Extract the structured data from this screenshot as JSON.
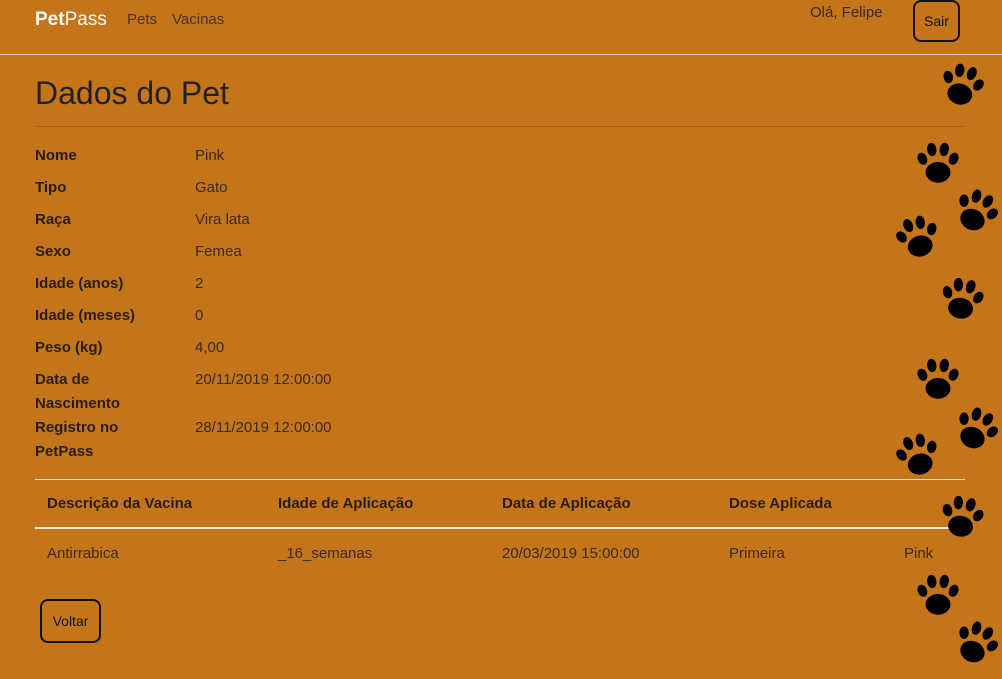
{
  "navbar": {
    "brand_bold": "Pet",
    "brand_rest": "Pass",
    "links": [
      "Pets",
      "Vacinas"
    ],
    "greeting": "Olá, Felipe",
    "logout_label": "Sair"
  },
  "page": {
    "title": "Dados do Pet"
  },
  "details": [
    {
      "label": "Nome",
      "value": "Pink"
    },
    {
      "label": "Tipo",
      "value": "Gato"
    },
    {
      "label": "Raça",
      "value": "Vira lata"
    },
    {
      "label": "Sexo",
      "value": "Femea"
    },
    {
      "label": "Idade (anos)",
      "value": "2"
    },
    {
      "label": "Idade (meses)",
      "value": "0"
    },
    {
      "label": "Peso (kg)",
      "value": "4,00"
    },
    {
      "label": "Data de Nascimento",
      "value": "20/11/2019 12:00:00"
    },
    {
      "label": "Registro no PetPass",
      "value": "28/11/2019 12:00:00"
    }
  ],
  "vaccines": {
    "headers": [
      "Descrição da Vacina",
      "Idade de Aplicação",
      "Data de Aplicação",
      "Dose Aplicada"
    ],
    "rows": [
      [
        "Antirrabica",
        "_16_semanas",
        "20/03/2019 15:00:00",
        "Primeira",
        "Pink"
      ]
    ]
  },
  "back_label": "Voltar",
  "decoration": {
    "icon": "paw-print-icon",
    "color": "#000000"
  },
  "colors": {
    "background": "#c4751a",
    "brand": "#ffffff"
  }
}
